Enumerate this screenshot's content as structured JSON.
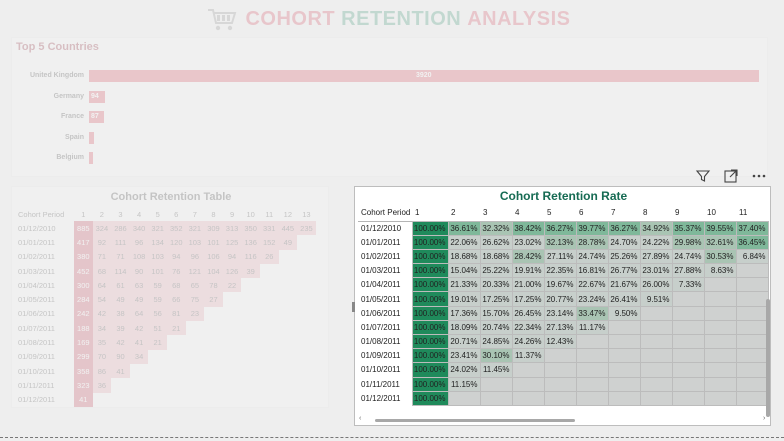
{
  "header": {
    "title_words": [
      "COHORT",
      "RETENTION",
      "ANALYSIS"
    ],
    "title_colors": [
      "#d63b52",
      "#2a8f6a",
      "#d63b52"
    ],
    "logo_icon": "shopping-cart-icon"
  },
  "countries": {
    "title": "Top 5 Countries",
    "items": [
      {
        "name": "United Kingdom",
        "value": 3920,
        "label": "3920"
      },
      {
        "name": "Germany",
        "value": 94,
        "label": "94"
      },
      {
        "name": "France",
        "value": 87,
        "label": "87"
      },
      {
        "name": "Spain",
        "value": 30,
        "label": ""
      },
      {
        "name": "Belgium",
        "value": 25,
        "label": ""
      }
    ],
    "bar_color": "#d93c4f"
  },
  "left_table": {
    "title": "Cohort Retention Table",
    "header_period": "Cohort Period",
    "columns": [
      "1",
      "2",
      "3",
      "4",
      "5",
      "6",
      "7",
      "8",
      "9",
      "10",
      "11",
      "12",
      "13"
    ],
    "rows": [
      {
        "period": "01/12/2010",
        "values": [
          "885",
          "324",
          "286",
          "340",
          "321",
          "352",
          "321",
          "309",
          "313",
          "350",
          "331",
          "445",
          "235"
        ]
      },
      {
        "period": "01/01/2011",
        "values": [
          "417",
          "92",
          "111",
          "96",
          "134",
          "120",
          "103",
          "101",
          "125",
          "136",
          "152",
          "49",
          ""
        ]
      },
      {
        "period": "01/02/2011",
        "values": [
          "380",
          "71",
          "71",
          "108",
          "103",
          "94",
          "96",
          "106",
          "94",
          "116",
          "26",
          "",
          ""
        ]
      },
      {
        "period": "01/03/2011",
        "values": [
          "452",
          "68",
          "114",
          "90",
          "101",
          "76",
          "121",
          "104",
          "126",
          "39",
          "",
          "",
          ""
        ]
      },
      {
        "period": "01/04/2011",
        "values": [
          "300",
          "64",
          "61",
          "63",
          "59",
          "68",
          "65",
          "78",
          "22",
          "",
          "",
          "",
          ""
        ]
      },
      {
        "period": "01/05/2011",
        "values": [
          "284",
          "54",
          "49",
          "49",
          "59",
          "66",
          "75",
          "27",
          "",
          "",
          "",
          "",
          ""
        ]
      },
      {
        "period": "01/06/2011",
        "values": [
          "242",
          "42",
          "38",
          "64",
          "56",
          "81",
          "23",
          "",
          "",
          "",
          "",
          "",
          ""
        ]
      },
      {
        "period": "01/07/2011",
        "values": [
          "188",
          "34",
          "39",
          "42",
          "51",
          "21",
          "",
          "",
          "",
          "",
          "",
          "",
          ""
        ]
      },
      {
        "period": "01/08/2011",
        "values": [
          "169",
          "35",
          "42",
          "41",
          "21",
          "",
          "",
          "",
          "",
          "",
          "",
          "",
          ""
        ]
      },
      {
        "period": "01/09/2011",
        "values": [
          "299",
          "70",
          "90",
          "34",
          "",
          "",
          "",
          "",
          "",
          "",
          "",
          "",
          ""
        ]
      },
      {
        "period": "01/10/2011",
        "values": [
          "358",
          "86",
          "41",
          "",
          "",
          "",
          "",
          "",
          "",
          "",
          "",
          "",
          ""
        ]
      },
      {
        "period": "01/11/2011",
        "values": [
          "323",
          "36",
          "",
          "",
          "",
          "",
          "",
          "",
          "",
          "",
          "",
          "",
          ""
        ]
      },
      {
        "period": "01/12/2011",
        "values": [
          "41",
          "",
          "",
          "",
          "",
          "",
          "",
          "",
          "",
          "",
          "",
          "",
          ""
        ]
      }
    ]
  },
  "rate_table": {
    "title": "Cohort Retention Rate",
    "header_period": "Cohort Period",
    "columns": [
      "1",
      "2",
      "3",
      "4",
      "5",
      "6",
      "7",
      "8",
      "9",
      "10",
      "11"
    ],
    "rows": [
      {
        "period": "01/12/2010",
        "values": [
          "100.00%",
          "36.61%",
          "32.32%",
          "38.42%",
          "36.27%",
          "39.77%",
          "36.27%",
          "34.92%",
          "35.37%",
          "39.55%",
          "37.40%"
        ]
      },
      {
        "period": "01/01/2011",
        "values": [
          "100.00%",
          "22.06%",
          "26.62%",
          "23.02%",
          "32.13%",
          "28.78%",
          "24.70%",
          "24.22%",
          "29.98%",
          "32.61%",
          "36.45%"
        ]
      },
      {
        "period": "01/02/2011",
        "values": [
          "100.00%",
          "18.68%",
          "18.68%",
          "28.42%",
          "27.11%",
          "24.74%",
          "25.26%",
          "27.89%",
          "24.74%",
          "30.53%",
          "6.84%"
        ]
      },
      {
        "period": "01/03/2011",
        "values": [
          "100.00%",
          "15.04%",
          "25.22%",
          "19.91%",
          "22.35%",
          "16.81%",
          "26.77%",
          "23.01%",
          "27.88%",
          "8.63%",
          ""
        ]
      },
      {
        "period": "01/04/2011",
        "values": [
          "100.00%",
          "21.33%",
          "20.33%",
          "21.00%",
          "19.67%",
          "22.67%",
          "21.67%",
          "26.00%",
          "7.33%",
          "",
          ""
        ]
      },
      {
        "period": "01/05/2011",
        "values": [
          "100.00%",
          "19.01%",
          "17.25%",
          "17.25%",
          "20.77%",
          "23.24%",
          "26.41%",
          "9.51%",
          "",
          "",
          ""
        ]
      },
      {
        "period": "01/06/2011",
        "values": [
          "100.00%",
          "17.36%",
          "15.70%",
          "26.45%",
          "23.14%",
          "33.47%",
          "9.50%",
          "",
          "",
          "",
          ""
        ]
      },
      {
        "period": "01/07/2011",
        "values": [
          "100.00%",
          "18.09%",
          "20.74%",
          "22.34%",
          "27.13%",
          "11.17%",
          "",
          "",
          "",
          "",
          ""
        ]
      },
      {
        "period": "01/08/2011",
        "values": [
          "100.00%",
          "20.71%",
          "24.85%",
          "24.26%",
          "12.43%",
          "",
          "",
          "",
          "",
          "",
          ""
        ]
      },
      {
        "period": "01/09/2011",
        "values": [
          "100.00%",
          "23.41%",
          "30.10%",
          "11.37%",
          "",
          "",
          "",
          "",
          "",
          "",
          ""
        ]
      },
      {
        "period": "01/10/2011",
        "values": [
          "100.00%",
          "24.02%",
          "11.45%",
          "",
          "",
          "",
          "",
          "",
          "",
          "",
          ""
        ]
      },
      {
        "period": "01/11/2011",
        "values": [
          "100.00%",
          "11.15%",
          "",
          "",
          "",
          "",
          "",
          "",
          "",
          "",
          ""
        ]
      },
      {
        "period": "01/12/2011",
        "values": [
          "100.00%",
          "",
          "",
          "",
          "",
          "",
          "",
          "",
          "",
          "",
          ""
        ]
      }
    ],
    "colors": {
      "full": "#1f8a5b",
      "high": "#7fb89a",
      "mid": "#a9c4b3",
      "low": "#c7cfcb",
      "empty": "#cfd1d0"
    }
  },
  "toolbar": {
    "icons": [
      "filter-icon",
      "focus-mode-icon",
      "more-options-icon"
    ]
  }
}
